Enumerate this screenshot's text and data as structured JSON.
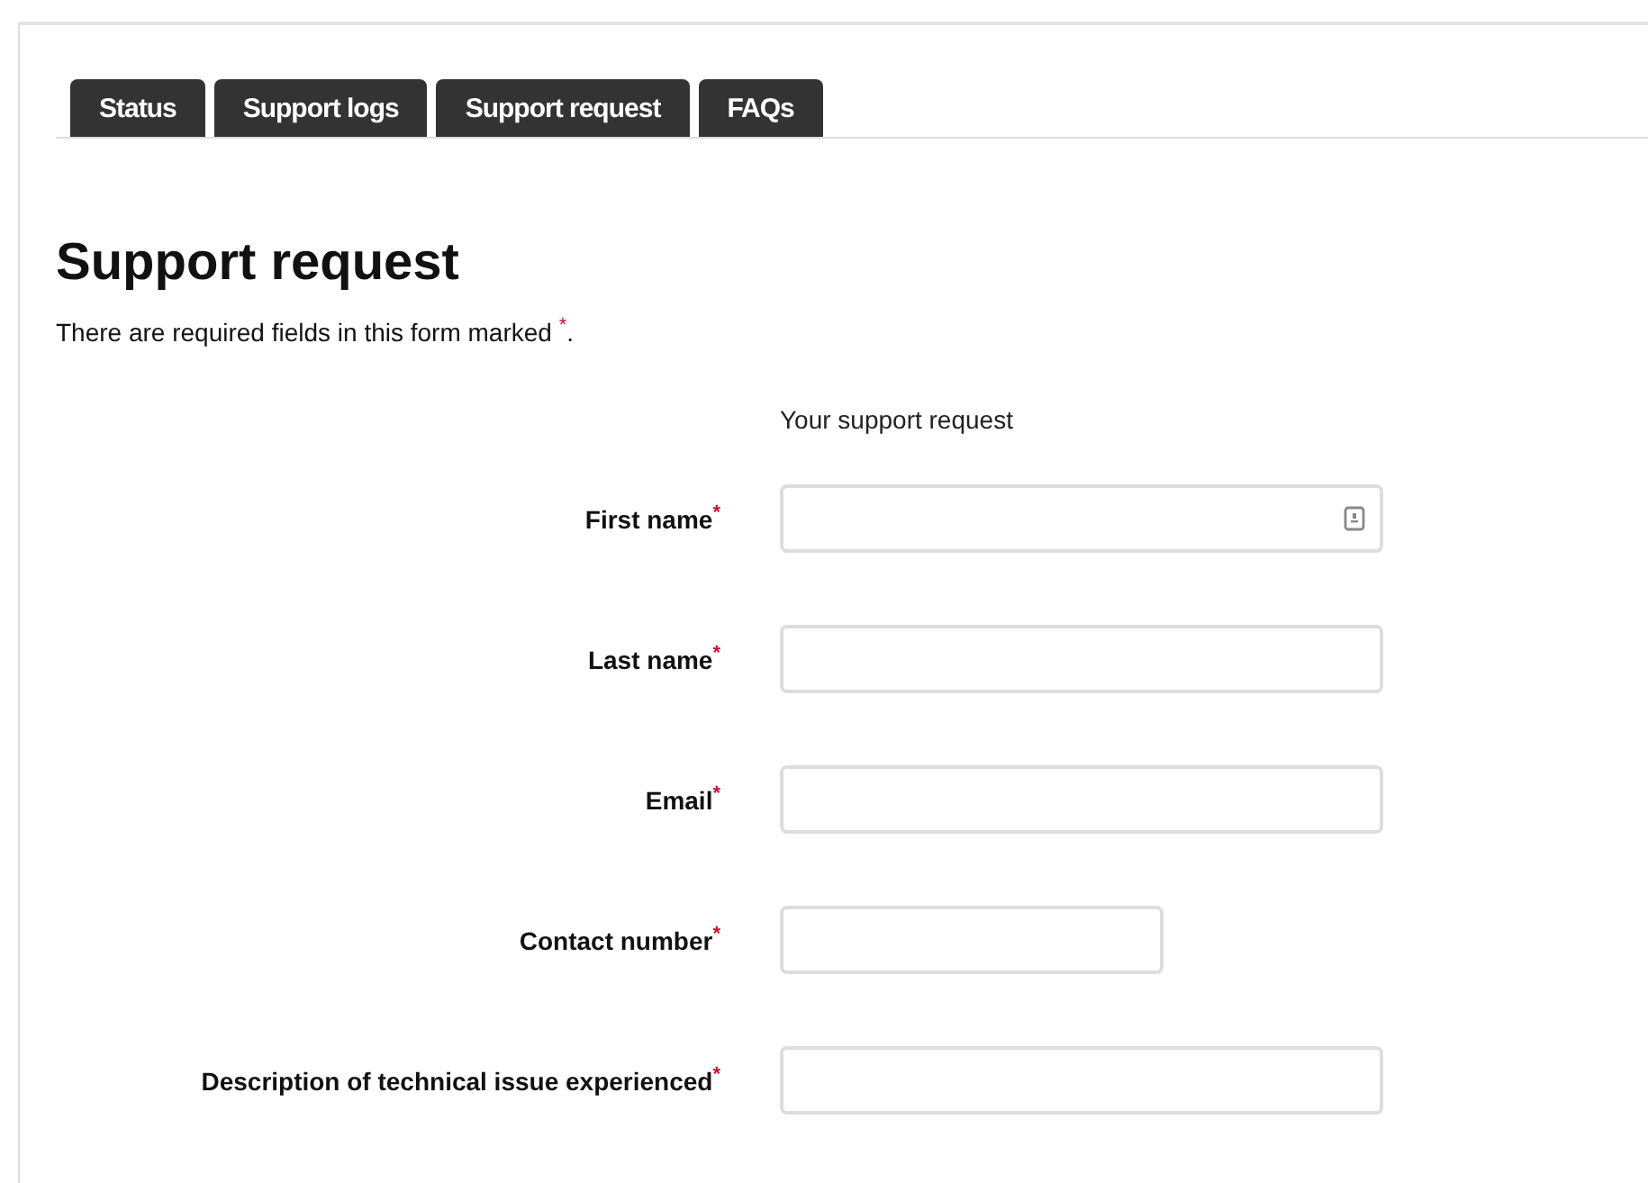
{
  "tabs": [
    {
      "label": "Status",
      "selected": false
    },
    {
      "label": "Support logs",
      "selected": false
    },
    {
      "label": "Support request",
      "selected": false
    },
    {
      "label": "FAQs",
      "selected": false
    }
  ],
  "heading": "Support request",
  "intro": "There are required fields in this form marked $^{*}$.",
  "form": {
    "legend": "Your support request",
    "fields": [
      {
        "label": "First name$^{*}$",
        "kind": "wide",
        "autofill_icon": true
      },
      {
        "label": "Last name$^{*}$",
        "kind": "wide",
        "autofill_icon": false
      },
      {
        "label": "Email$^{*}$",
        "kind": "wide",
        "autofill_icon": false
      },
      {
        "label": "Contact number$^{*}$",
        "kind": "short",
        "autofill_icon": false
      },
      {
        "label": "Description of technical issue experienced$^{*}$",
        "kind": "wide",
        "autofill_icon": false
      }
    ]
  }
}
